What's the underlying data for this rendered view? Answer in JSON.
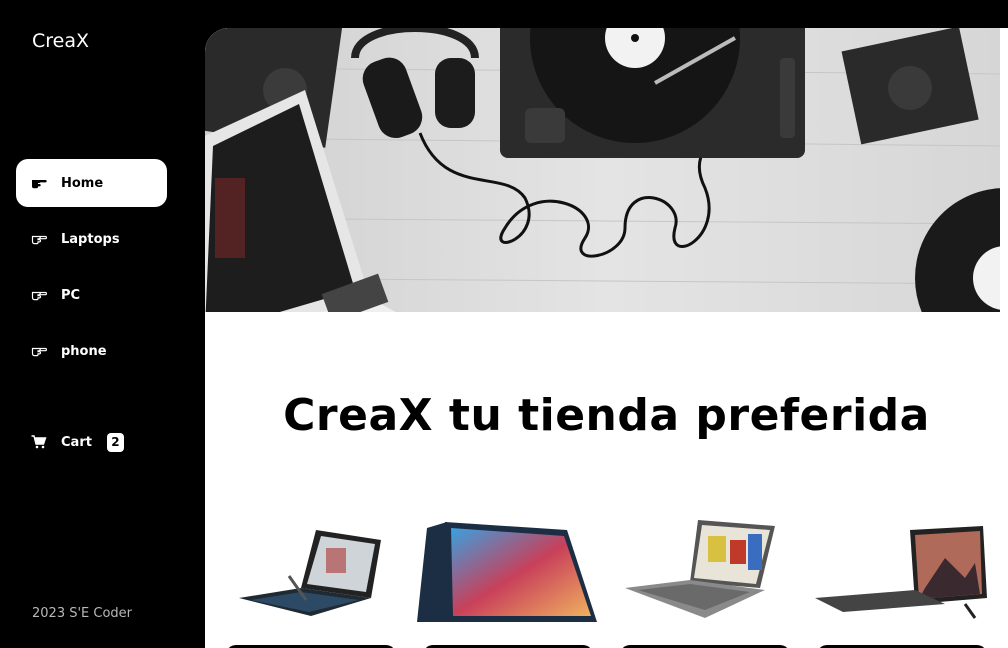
{
  "brand": {
    "name": "CreaX"
  },
  "nav": {
    "items": [
      {
        "label": "Home",
        "icon": "hand-pointer-icon",
        "active": true
      },
      {
        "label": "Laptops",
        "icon": "hand-pointer-icon"
      },
      {
        "label": "PC",
        "icon": "hand-pointer-icon"
      },
      {
        "label": "phone",
        "icon": "hand-pointer-icon"
      }
    ],
    "cart": {
      "label": "Cart",
      "count": "2",
      "icon": "cart-icon"
    }
  },
  "footer": {
    "text": "2023 S'E Coder"
  },
  "main": {
    "headline": "CreaX tu tienda preferida",
    "hero_image": "music-desk-photo",
    "products": [
      {
        "image": "laptop-dual-screen"
      },
      {
        "image": "laptop-convertible"
      },
      {
        "image": "laptop-gray"
      },
      {
        "image": "tablet-keyboard"
      }
    ]
  },
  "colors": {
    "sidebar_bg": "#000000",
    "content_bg": "#ffffff",
    "active_item_bg": "#ffffff"
  }
}
